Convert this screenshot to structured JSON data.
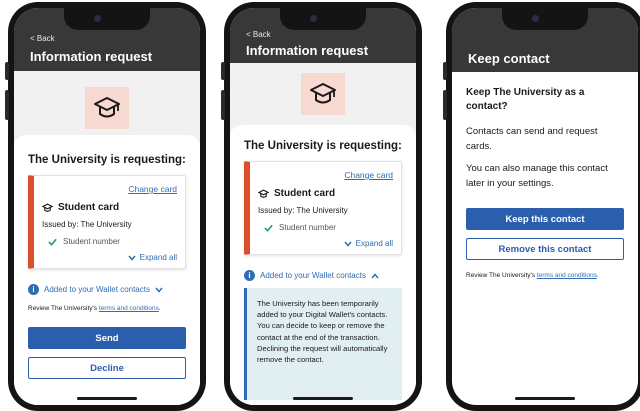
{
  "screens": [
    {
      "back_label": "< Back",
      "title": "Information request",
      "requesting": "The University is requesting:",
      "change_card": "Change card",
      "card_name": "Student card",
      "issued_by": "Issued by: The University",
      "attribute": "Student number",
      "expand_all": "Expand all",
      "added_label": "Added to your Wallet contacts",
      "review_prefix": "Review The University's ",
      "review_link": "terms and conditions",
      "review_suffix": ".",
      "send_label": "Send",
      "decline_label": "Decline"
    },
    {
      "back_label": "< Back",
      "title": "Information request",
      "requesting": "The University is requesting:",
      "change_card": "Change card",
      "card_name": "Student card",
      "issued_by": "Issued by: The University",
      "attribute": "Student number",
      "expand_all": "Expand all",
      "added_label": "Added to your Wallet contacts",
      "info_text": "The University has been temporarily added to your Digital Wallet's contacts. You can decide to keep or remove the contact at the end of the transaction. Declining the request will automatically remove the contact."
    },
    {
      "title": "Keep contact",
      "question": "Keep The University as a contact?",
      "para1": "Contacts can send and request cards.",
      "para2": "You can also manage this contact later in your settings.",
      "keep_label": "Keep this contact",
      "remove_label": "Remove this contact",
      "review_prefix": "Review The University's ",
      "review_link": "terms and conditions",
      "review_suffix": "."
    }
  ],
  "colors": {
    "header": "#383838",
    "primary_button": "#2b5fad",
    "link": "#2f6cb3",
    "card_accent": "#d94f2b",
    "icon_box": "#f7d9d2",
    "info_panel": "#e1eef2",
    "check": "#2e9b62"
  },
  "icons": [
    "graduation-cap-icon",
    "check-icon",
    "chevron-down-icon",
    "chevron-up-icon",
    "info-icon"
  ]
}
